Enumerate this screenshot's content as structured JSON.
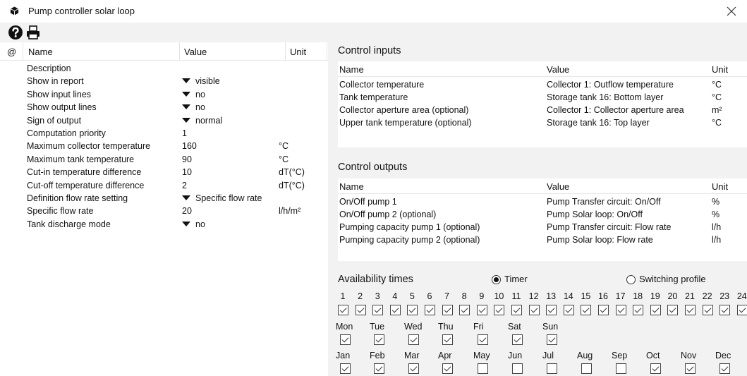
{
  "window": {
    "title": "Pump controller solar loop"
  },
  "toolbar": {
    "help_icon": "question-circle-icon",
    "print_icon": "printer-icon"
  },
  "params": {
    "headers": {
      "at": "@",
      "name": "Name",
      "value": "Value",
      "unit": "Unit"
    },
    "rows": [
      {
        "name": "Description",
        "value": "",
        "unit": "",
        "dropdown": false
      },
      {
        "name": "Show in report",
        "value": "visible",
        "unit": "",
        "dropdown": true
      },
      {
        "name": "Show input lines",
        "value": "no",
        "unit": "",
        "dropdown": true
      },
      {
        "name": "Show output lines",
        "value": "no",
        "unit": "",
        "dropdown": true
      },
      {
        "name": "Sign of output",
        "value": "normal",
        "unit": "",
        "dropdown": true
      },
      {
        "name": "Computation priority",
        "value": "1",
        "unit": "",
        "dropdown": false
      },
      {
        "name": "Maximum collector temperature",
        "value": "160",
        "unit": "°C",
        "dropdown": false
      },
      {
        "name": "Maximum tank temperature",
        "value": "90",
        "unit": "°C",
        "dropdown": false
      },
      {
        "name": "Cut-in temperature difference",
        "value": "10",
        "unit": "dT(°C)",
        "dropdown": false
      },
      {
        "name": "Cut-off temperature difference",
        "value": "2",
        "unit": "dT(°C)",
        "dropdown": false
      },
      {
        "name": "Definition flow rate setting",
        "value": "Specific flow rate",
        "unit": "",
        "dropdown": true
      },
      {
        "name": "Specific flow rate",
        "value": "20",
        "unit": "l/h/m²",
        "dropdown": false
      },
      {
        "name": "Tank discharge mode",
        "value": "no",
        "unit": "",
        "dropdown": true
      }
    ]
  },
  "control_inputs": {
    "title": "Control inputs",
    "headers": {
      "name": "Name",
      "value": "Value",
      "unit": "Unit"
    },
    "rows": [
      {
        "name": "Collector temperature",
        "value": "Collector 1: Outflow temperature",
        "unit": "°C"
      },
      {
        "name": "Tank temperature",
        "value": "Storage tank 16: Bottom layer",
        "unit": "°C"
      },
      {
        "name": "Collector aperture area (optional)",
        "value": "Collector 1: Collector aperture area",
        "unit": "m²"
      },
      {
        "name": "Upper tank temperature (optional)",
        "value": "Storage tank 16: Top layer",
        "unit": "°C"
      }
    ]
  },
  "control_outputs": {
    "title": "Control outputs",
    "headers": {
      "name": "Name",
      "value": "Value",
      "unit": "Unit"
    },
    "rows": [
      {
        "name": "On/Off pump 1",
        "value": "Pump Transfer circuit: On/Off",
        "unit": "%"
      },
      {
        "name": "On/Off pump 2 (optional)",
        "value": "Pump Solar loop: On/Off",
        "unit": "%"
      },
      {
        "name": "Pumping capacity pump 1 (optional)",
        "value": "Pump Transfer circuit: Flow rate",
        "unit": "l/h"
      },
      {
        "name": "Pumping capacity pump 2 (optional)",
        "value": "Pump Solar loop: Flow rate",
        "unit": "l/h"
      }
    ]
  },
  "availability": {
    "title": "Availability times",
    "timer_label": "Timer",
    "timer_selected": true,
    "profile_label": "Switching profile",
    "profile_selected": false,
    "hours": [
      {
        "label": "1",
        "checked": true
      },
      {
        "label": "2",
        "checked": true
      },
      {
        "label": "3",
        "checked": true
      },
      {
        "label": "4",
        "checked": true
      },
      {
        "label": "5",
        "checked": true
      },
      {
        "label": "6",
        "checked": true
      },
      {
        "label": "7",
        "checked": true
      },
      {
        "label": "8",
        "checked": true
      },
      {
        "label": "9",
        "checked": true
      },
      {
        "label": "10",
        "checked": true
      },
      {
        "label": "11",
        "checked": true
      },
      {
        "label": "12",
        "checked": true
      },
      {
        "label": "13",
        "checked": true
      },
      {
        "label": "14",
        "checked": true
      },
      {
        "label": "15",
        "checked": true
      },
      {
        "label": "16",
        "checked": true
      },
      {
        "label": "17",
        "checked": true
      },
      {
        "label": "18",
        "checked": true
      },
      {
        "label": "19",
        "checked": true
      },
      {
        "label": "20",
        "checked": true
      },
      {
        "label": "21",
        "checked": true
      },
      {
        "label": "22",
        "checked": true
      },
      {
        "label": "23",
        "checked": true
      },
      {
        "label": "24",
        "checked": true
      }
    ],
    "days": [
      {
        "label": "Mon",
        "checked": true
      },
      {
        "label": "Tue",
        "checked": true
      },
      {
        "label": "Wed",
        "checked": true
      },
      {
        "label": "Thu",
        "checked": true
      },
      {
        "label": "Fri",
        "checked": true
      },
      {
        "label": "Sat",
        "checked": true
      },
      {
        "label": "Sun",
        "checked": true
      }
    ],
    "months": [
      {
        "label": "Jan",
        "checked": true
      },
      {
        "label": "Feb",
        "checked": true
      },
      {
        "label": "Mar",
        "checked": true
      },
      {
        "label": "Apr",
        "checked": true
      },
      {
        "label": "May",
        "checked": false
      },
      {
        "label": "Jun",
        "checked": false
      },
      {
        "label": "Jul",
        "checked": false
      },
      {
        "label": "Aug",
        "checked": false
      },
      {
        "label": "Sep",
        "checked": false
      },
      {
        "label": "Oct",
        "checked": true
      },
      {
        "label": "Nov",
        "checked": true
      },
      {
        "label": "Dec",
        "checked": true
      }
    ]
  }
}
